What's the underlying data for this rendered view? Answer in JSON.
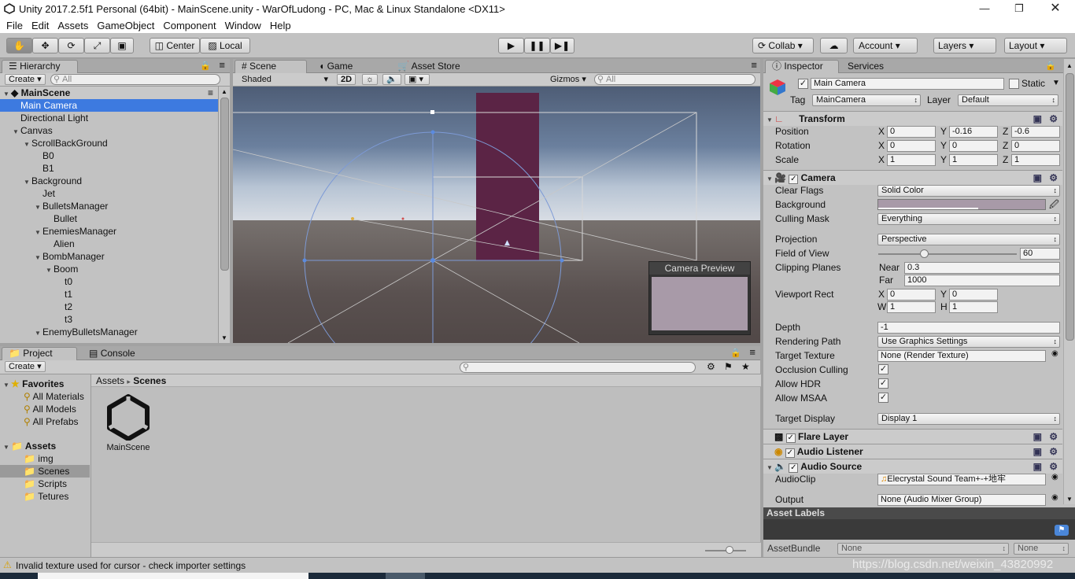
{
  "window": {
    "title": "Unity 2017.2.5f1 Personal (64bit) - MainScene.unity - WarOfLudong - PC, Mac & Linux Standalone <DX11>"
  },
  "menu": [
    "File",
    "Edit",
    "Assets",
    "GameObject",
    "Component",
    "Window",
    "Help"
  ],
  "toolbar": {
    "pivot": "Center",
    "space": "Local",
    "collab": "Collab",
    "account": "Account",
    "layers": "Layers",
    "layout": "Layout"
  },
  "hierarchy": {
    "tab": "Hierarchy",
    "create": "Create",
    "search_placeholder": "All",
    "scene": "MainScene",
    "items": [
      {
        "label": "Main Camera",
        "depth": 1,
        "arrow": "",
        "selected": true
      },
      {
        "label": "Directional Light",
        "depth": 1,
        "arrow": ""
      },
      {
        "label": "Canvas",
        "depth": 1,
        "arrow": "▼"
      },
      {
        "label": "ScrollBackGround",
        "depth": 2,
        "arrow": "▼"
      },
      {
        "label": "B0",
        "depth": 3,
        "arrow": ""
      },
      {
        "label": "B1",
        "depth": 3,
        "arrow": ""
      },
      {
        "label": "Background",
        "depth": 2,
        "arrow": "▼"
      },
      {
        "label": "Jet",
        "depth": 3,
        "arrow": ""
      },
      {
        "label": "BulletsManager",
        "depth": 3,
        "arrow": "▼"
      },
      {
        "label": "Bullet",
        "depth": 4,
        "arrow": ""
      },
      {
        "label": "EnemiesManager",
        "depth": 3,
        "arrow": "▼"
      },
      {
        "label": "Alien",
        "depth": 4,
        "arrow": ""
      },
      {
        "label": "BombManager",
        "depth": 3,
        "arrow": "▼"
      },
      {
        "label": "Boom",
        "depth": 4,
        "arrow": "▼"
      },
      {
        "label": "t0",
        "depth": 5,
        "arrow": ""
      },
      {
        "label": "t1",
        "depth": 5,
        "arrow": ""
      },
      {
        "label": "t2",
        "depth": 5,
        "arrow": ""
      },
      {
        "label": "t3",
        "depth": 5,
        "arrow": ""
      },
      {
        "label": "EnemyBulletsManager",
        "depth": 3,
        "arrow": "▼"
      }
    ]
  },
  "scene": {
    "tabs": [
      "Scene",
      "Game",
      "Asset Store"
    ],
    "shading": "Shaded",
    "mode2d": "2D",
    "gizmos": "Gizmos",
    "search_placeholder": "All",
    "preview_title": "Camera Preview"
  },
  "project": {
    "tabs": [
      "Project",
      "Console"
    ],
    "create": "Create",
    "favorites": {
      "label": "Favorites",
      "items": [
        "All Materials",
        "All Models",
        "All Prefabs"
      ]
    },
    "assets": {
      "label": "Assets",
      "items": [
        "img",
        "Scenes",
        "Scripts",
        "Tetures"
      ],
      "selected": "Scenes"
    },
    "breadcrumb": [
      "Assets",
      "Scenes"
    ],
    "file": "MainScene"
  },
  "inspector": {
    "tabs": [
      "Inspector",
      "Services"
    ],
    "name": "Main Camera",
    "static_label": "Static",
    "tag_label": "Tag",
    "tag": "MainCamera",
    "layer_label": "Layer",
    "layer": "Default",
    "transform": {
      "title": "Transform",
      "position_label": "Position",
      "position": [
        "0",
        "-0.16",
        "-0.6"
      ],
      "rotation_label": "Rotation",
      "rotation": [
        "0",
        "0",
        "0"
      ],
      "scale_label": "Scale",
      "scale": [
        "1",
        "1",
        "1"
      ]
    },
    "camera": {
      "title": "Camera",
      "clear_flags_label": "Clear Flags",
      "clear_flags": "Solid Color",
      "background_label": "Background",
      "background_color": "#a89aa8",
      "culling_mask_label": "Culling Mask",
      "culling_mask": "Everything",
      "projection_label": "Projection",
      "projection": "Perspective",
      "fov_label": "Field of View",
      "fov": "60",
      "fov_fraction": 0.33,
      "clipping_label": "Clipping Planes",
      "near_label": "Near",
      "near": "0.3",
      "far_label": "Far",
      "far": "1000",
      "viewport_label": "Viewport Rect",
      "vx": "0",
      "vy": "0",
      "vw": "1",
      "vh": "1",
      "depth_label": "Depth",
      "depth": "-1",
      "rendering_path_label": "Rendering Path",
      "rendering_path": "Use Graphics Settings",
      "target_texture_label": "Target Texture",
      "target_texture": "None (Render Texture)",
      "occlusion_label": "Occlusion Culling",
      "hdr_label": "Allow HDR",
      "msaa_label": "Allow MSAA",
      "target_display_label": "Target Display",
      "target_display": "Display 1"
    },
    "flare_layer": "Flare Layer",
    "audio_listener": "Audio Listener",
    "audio_source": {
      "title": "Audio Source",
      "clip_label": "AudioClip",
      "clip": "Elecrystal Sound Team+-+地牢",
      "output_label": "Output",
      "output": "None (Audio Mixer Group)"
    },
    "asset_labels": "Asset Labels",
    "assetbundle_label": "AssetBundle",
    "assetbundle": "None",
    "assetbundle_variant": "None"
  },
  "status": {
    "message": "Invalid texture used for cursor - check importer settings"
  },
  "watermark": "https://blog.csdn.net/weixin_43820992",
  "colors": {
    "selection": "#3d7ae0",
    "sky_top": "#4f5f78",
    "ground": "#5d5352",
    "quad": "#5c2446"
  }
}
